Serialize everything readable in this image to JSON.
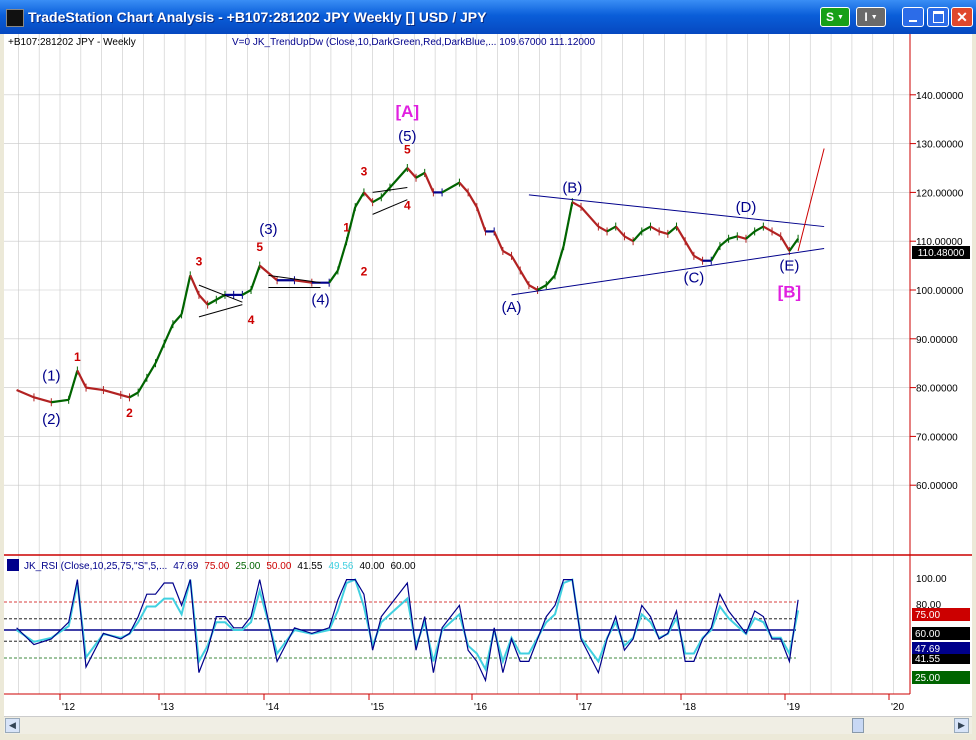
{
  "window": {
    "title": "TradeStation Chart Analysis - +B107:281202 JPY Weekly [] USD / JPY",
    "buttons": {
      "s": "S",
      "i": "I"
    }
  },
  "chart": {
    "symbol_label": "+B107:281202 JPY - Weekly",
    "indicator_label": "V=0  JK_TrendUpDw (Close,10,DarkGreen,Red,DarkBlue,...  109.67000  111.12000",
    "last_price": "110.48000",
    "price_axis": [
      "140.00000",
      "130.00000",
      "120.00000",
      "110.00000",
      "100.00000",
      "90.00000",
      "80.00000",
      "70.00000",
      "60.00000"
    ],
    "x_axis": [
      "'12",
      "'13",
      "'14",
      "'15",
      "'16",
      "'17",
      "'18",
      "'19",
      "'20"
    ],
    "rsi_label": {
      "name": "JK_RSI (Close,10,25,75,\"S\",5,...",
      "v1": "47.69",
      "v2": "75.00",
      "v3": "25.00",
      "v4": "50.00",
      "v5": "41.55",
      "v6": "49.56",
      "v7": "40.00",
      "v8": "60.00"
    },
    "rsi_axis": [
      "100.00",
      "80.00"
    ],
    "rsi_tags": [
      "75.00",
      "60.00",
      "47.69",
      "41.55",
      "25.00"
    ],
    "wave_labels": {
      "A_big": "[A]",
      "B_big": "[B]",
      "w1": "(1)",
      "w2": "(2)",
      "w3": "(3)",
      "w4": "(4)",
      "w5": "(5)",
      "wa": "(A)",
      "wb": "(B)",
      "wc": "(C)",
      "wd": "(D)",
      "we": "(E)",
      "r1a": "1",
      "r2a": "2",
      "r3a": "3",
      "r4a": "4",
      "r5a": "5",
      "r1b": "1",
      "r2b": "2",
      "r3b": "3",
      "r4b": "4",
      "r5b": "5"
    }
  },
  "colors": {
    "up": "#006400",
    "down": "#b22222",
    "neutral": "#00008b",
    "wave_blue": "#00008b",
    "wave_red": "#cc0000",
    "wave_magenta": "#e020e0",
    "axis_red": "#cc0000",
    "rsi_cyan": "#40d0e0"
  },
  "chart_data": {
    "type": "line",
    "title": "+B107:281202 JPY - Weekly",
    "ylim": [
      50,
      150
    ],
    "x": [
      "2011-08",
      "2011-10",
      "2011-12",
      "2012-02",
      "2012-03",
      "2012-04",
      "2012-06",
      "2012-08",
      "2012-09",
      "2012-10",
      "2012-11",
      "2012-12",
      "2013-01",
      "2013-02",
      "2013-03",
      "2013-04",
      "2013-05",
      "2013-06",
      "2013-07",
      "2013-08",
      "2013-09",
      "2013-10",
      "2013-11",
      "2013-12",
      "2014-02",
      "2014-04",
      "2014-06",
      "2014-08",
      "2014-09",
      "2014-10",
      "2014-11",
      "2014-12",
      "2015-01",
      "2015-02",
      "2015-03",
      "2015-05",
      "2015-06",
      "2015-07",
      "2015-08",
      "2015-09",
      "2015-11",
      "2015-12",
      "2016-01",
      "2016-02",
      "2016-03",
      "2016-04",
      "2016-05",
      "2016-06",
      "2016-07",
      "2016-08",
      "2016-09",
      "2016-10",
      "2016-11",
      "2016-12",
      "2017-01",
      "2017-03",
      "2017-04",
      "2017-05",
      "2017-06",
      "2017-07",
      "2017-08",
      "2017-09",
      "2017-10",
      "2017-11",
      "2017-12",
      "2018-01",
      "2018-02",
      "2018-03",
      "2018-04",
      "2018-05",
      "2018-06",
      "2018-07",
      "2018-08",
      "2018-09",
      "2018-10",
      "2018-11",
      "2018-12",
      "2019-01",
      "2019-02"
    ],
    "series": [
      {
        "values": [
          79.5,
          78,
          77,
          77.5,
          83.5,
          80,
          79.5,
          78.5,
          78,
          79,
          82,
          85,
          89,
          93,
          95,
          103,
          99,
          97,
          98,
          99,
          99,
          99,
          100,
          105,
          102,
          102,
          101.5,
          101.5,
          104,
          110,
          117,
          120,
          118,
          119,
          121,
          125,
          123,
          124,
          120,
          120,
          122,
          120,
          117,
          112,
          112,
          108,
          107,
          104,
          101,
          100,
          101,
          103,
          109,
          118,
          117,
          113,
          112,
          113,
          111,
          110,
          112,
          113,
          112,
          111.5,
          113,
          110,
          107,
          106,
          106,
          109,
          110.5,
          111,
          110.5,
          112,
          113,
          112,
          111,
          108,
          110.5
        ]
      }
    ],
    "rsi": {
      "ylim": [
        0,
        100
      ],
      "levels": [
        25,
        40,
        50,
        60,
        75
      ],
      "last": 47.69
    }
  }
}
